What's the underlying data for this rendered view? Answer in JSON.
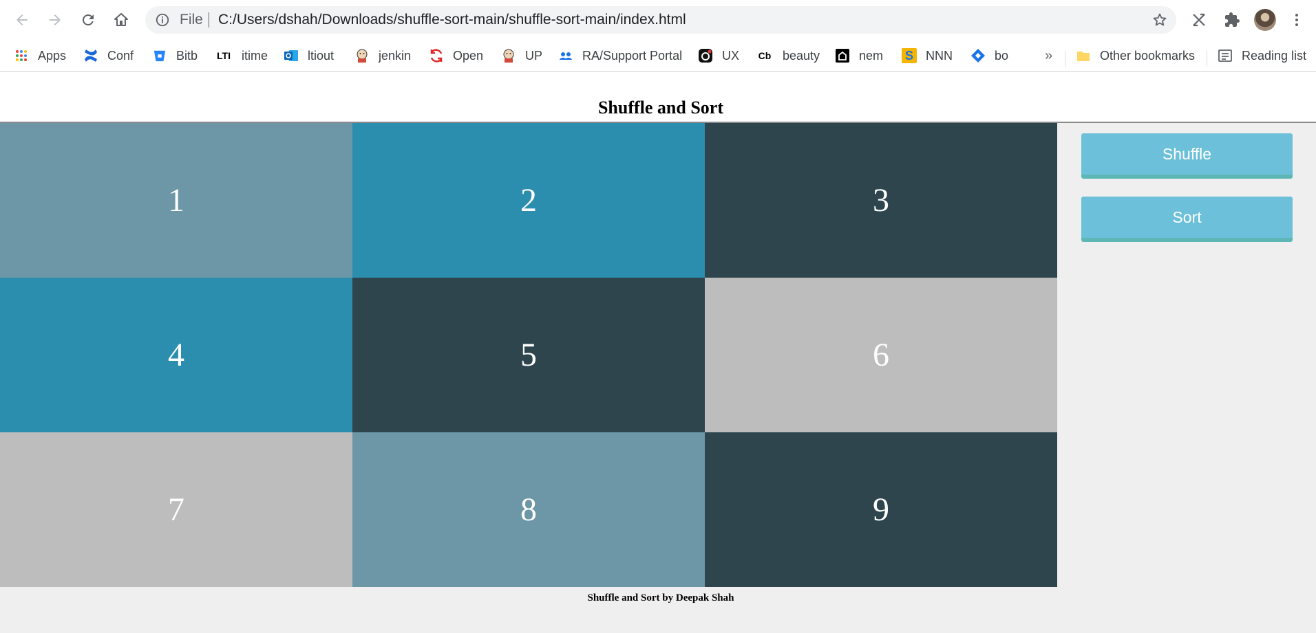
{
  "browser": {
    "address": {
      "scheme_label": "File",
      "url": "C:/Users/dshah/Downloads/shuffle-sort-main/shuffle-sort-main/index.html"
    },
    "bookmarks": [
      {
        "label": "Apps",
        "icon": "apps-grid-icon"
      },
      {
        "label": "Conf",
        "icon": "confluence-icon"
      },
      {
        "label": "Bitb",
        "icon": "bitbucket-icon"
      },
      {
        "label": "itime",
        "icon": "lti-icon",
        "icon_text": "LTI"
      },
      {
        "label": "ltiout",
        "icon": "outlook-icon"
      },
      {
        "label": "jenkin",
        "icon": "jenkins-icon"
      },
      {
        "label": "Open",
        "icon": "open-sync-icon"
      },
      {
        "label": "UP",
        "icon": "jenkins-icon"
      },
      {
        "label": "RA/Support Portal",
        "icon": "support-portal-icon"
      },
      {
        "label": "UX",
        "icon": "ux-icon"
      },
      {
        "label": "beauty",
        "icon": "cb-icon",
        "icon_text": "Cb"
      },
      {
        "label": "nem",
        "icon": "nem-icon"
      },
      {
        "label": "NNN",
        "icon": "nnn-icon",
        "icon_text": "S"
      },
      {
        "label": "bo",
        "icon": "diamond-icon"
      }
    ],
    "overflow_label": "»",
    "other_bookmarks": "Other bookmarks",
    "reading_list": "Reading list"
  },
  "page": {
    "title": "Shuffle and Sort",
    "tiles": [
      {
        "number": "1",
        "color": "#6d97a7"
      },
      {
        "number": "2",
        "color": "#2b8eae"
      },
      {
        "number": "3",
        "color": "#2e454e"
      },
      {
        "number": "4",
        "color": "#2b8eae"
      },
      {
        "number": "5",
        "color": "#2e454e"
      },
      {
        "number": "6",
        "color": "#bdbdbd"
      },
      {
        "number": "7",
        "color": "#bdbdbd"
      },
      {
        "number": "8",
        "color": "#6d97a7"
      },
      {
        "number": "9",
        "color": "#2e454e"
      }
    ],
    "buttons": {
      "shuffle": "Shuffle",
      "sort": "Sort"
    },
    "footer": "Shuffle and Sort by Deepak Shah"
  },
  "colors": {
    "button": "#6cc0d9",
    "button_border": "#5db8b5",
    "page_background": "#efefef"
  }
}
